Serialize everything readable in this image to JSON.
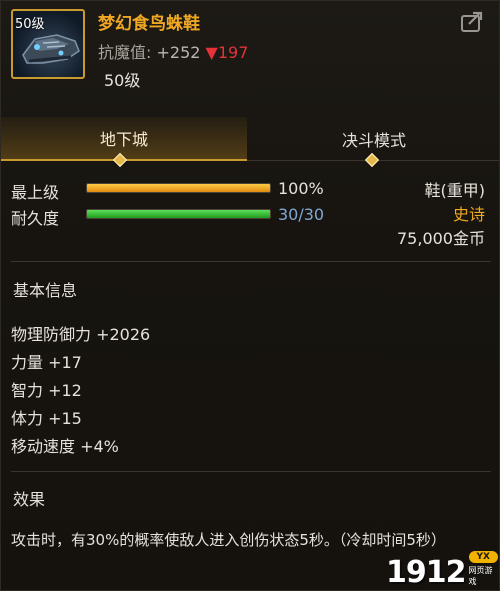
{
  "item": {
    "level_badge": "50级",
    "name": "梦幻食鸟蛛鞋",
    "resist_label": "抗魔值:",
    "resist_value": "+252",
    "resist_diff": "▼197",
    "level_text": "50级"
  },
  "tabs": [
    {
      "label": "地下城",
      "active": true
    },
    {
      "label": "决斗模式",
      "active": false
    }
  ],
  "stats": {
    "max_level_label": "最上级",
    "max_level_value": "100%",
    "max_level_fraction": 1.0,
    "durability_label": "耐久度",
    "durability_value": "30/30",
    "durability_fraction": 1.0
  },
  "info": {
    "type": "鞋(重甲)",
    "rarity": "史诗",
    "price": "75,000金币"
  },
  "basic_info": {
    "title": "基本信息",
    "lines": [
      "物理防御力 +2026",
      "力量 +17",
      "智力 +12",
      "体力 +15",
      "移动速度 +4%"
    ]
  },
  "effect": {
    "title": "效果",
    "text": "攻击时，有30%的概率使敌人进入创伤状态5秒。（冷却时间5秒）"
  },
  "watermark": {
    "digits": "1912",
    "badge": "YX",
    "sub": "网页游戏"
  },
  "colors": {
    "item_name": "#f0a722",
    "resist_down": "#e3323a",
    "rarity_epic": "#f0a722",
    "durability_text": "#7fa8d6",
    "tab_accent": "#c99a2e"
  },
  "icons": [
    "boots-item-icon",
    "share-icon"
  ]
}
